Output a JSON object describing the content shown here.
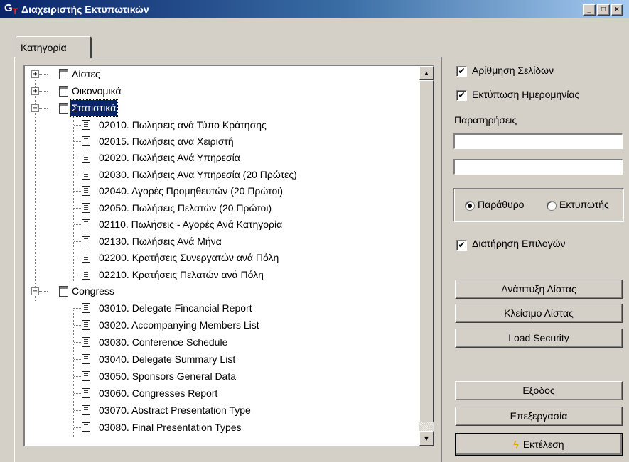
{
  "window": {
    "icon_g": "G",
    "icon_t": "T",
    "title": "Διαχειριστής Εκτυπωτικών",
    "minimize": "_",
    "maximize": "□",
    "close": "×"
  },
  "tabs": [
    {
      "label": "Κατηγορία",
      "active": true
    }
  ],
  "tree": {
    "groups": [
      {
        "label": "Λίστες",
        "expanded": false,
        "items": []
      },
      {
        "label": "Οικονομικά",
        "expanded": false,
        "items": []
      },
      {
        "label": "Στατιστικά",
        "expanded": true,
        "selected": true,
        "items": [
          "02010. Πωλησεις ανά Τύπο Κράτησης",
          "02015. Πωλήσεις ανα Χειριστή",
          "02020. Πωλήσεις Ανά Υπηρεσία",
          "02030. Πωλήσεις Ανα Υπηρεσία (20 Πρώτες)",
          "02040. Αγορές Προμηθευτών (20 Πρώτοι)",
          "02050. Πωλήσεις Πελατών (20 Πρώτοι)",
          "02110. Πωλήσεις - Αγορές Ανά Κατηγορία",
          "02130. Πωλήσεις Ανά Μήνα",
          "02200. Κρατήσεις Συνεργατών ανά Πόλη",
          "02210. Κρατήσεις Πελατών ανά Πόλη"
        ]
      },
      {
        "label": "Congress",
        "expanded": true,
        "items": [
          "03010. Delegate Fincancial Report",
          "03020. Accompanying Members List",
          "03030. Conference Schedule",
          "03040. Delegate Summary List",
          "03050. Sponsors General Data",
          "03060. Congresses Report",
          "03070. Abstract Presentation Type",
          "03080. Final Presentation Types"
        ]
      }
    ]
  },
  "options": {
    "page_numbering": {
      "label": "Αρίθμηση Σελίδων",
      "checked": true
    },
    "print_date": {
      "label": "Εκτύπωση Ημερομηνίας",
      "checked": true
    },
    "remarks_label": "Παρατηρήσεις",
    "remarks_1": "",
    "remarks_2": "",
    "output": {
      "window": {
        "label": "Παράθυρο",
        "selected": true
      },
      "printer": {
        "label": "Εκτυπωτής",
        "selected": false
      }
    },
    "keep_selections": {
      "label": "Διατήρηση Επιλογών",
      "checked": true
    }
  },
  "buttons": {
    "expand_list": "Ανάπτυξη Λίστας",
    "collapse_list": "Κλείσιμο Λίστας",
    "load_security": "Load Security",
    "exit": "Εξοδος",
    "edit": "Επεξεργασία",
    "execute": "Εκτέλεση"
  },
  "icons": {
    "check": "✔",
    "bolt": "ϟ",
    "scroll_up": "▲",
    "scroll_down": "▼",
    "expand": "+",
    "collapse": "−"
  }
}
